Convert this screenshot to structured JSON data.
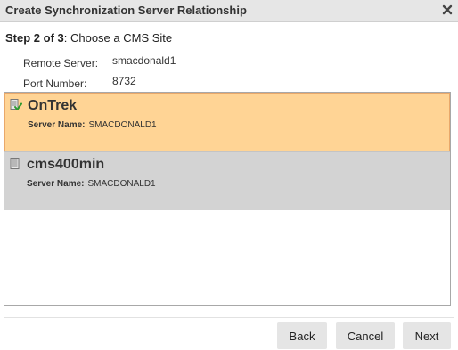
{
  "dialog": {
    "title": "Create Synchronization Server Relationship",
    "close_icon": "close-x-icon"
  },
  "step": {
    "prefix": "Step 2 of 3",
    "text": ": Choose a CMS Site"
  },
  "info": {
    "remote_server_label": "Remote Server:",
    "remote_server_value": "smacdonald1",
    "port_label": "Port Number:",
    "port_value": "8732"
  },
  "sites": [
    {
      "name": "OnTrek",
      "server_label": "Server Name:",
      "server_value": "SMACDONALD1",
      "selected": true,
      "icon": "site-selected-icon"
    },
    {
      "name": "cms400min",
      "server_label": "Server Name:",
      "server_value": "SMACDONALD1",
      "selected": false,
      "icon": "site-icon"
    }
  ],
  "buttons": {
    "back": "Back",
    "cancel": "Cancel",
    "next": "Next"
  },
  "colors": {
    "selected_bg": "#ffd495",
    "normal_bg": "#d3d3d3",
    "titlebar_bg": "#e6e6e6",
    "button_bg": "#e5e5e5"
  }
}
